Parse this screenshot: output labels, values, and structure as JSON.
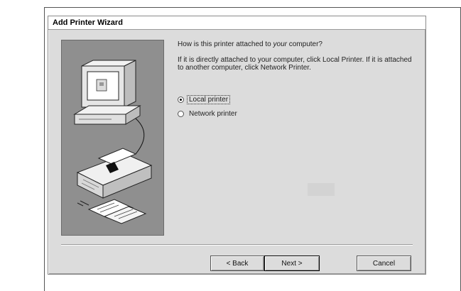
{
  "window": {
    "title": "Add Printer Wizard"
  },
  "main": {
    "question_prefix": "How is this printer attached to ",
    "question_emphasis": "your",
    "question_suffix": " computer?",
    "instructions": "If it is directly attached to your computer, click Local Printer. If it is attached to another computer, click Network Printer."
  },
  "options": [
    {
      "label": "Local printer",
      "selected": true
    },
    {
      "label": "Network printer",
      "selected": false
    }
  ],
  "buttons": {
    "back": "< Back",
    "next": "Next >",
    "cancel": "Cancel"
  }
}
